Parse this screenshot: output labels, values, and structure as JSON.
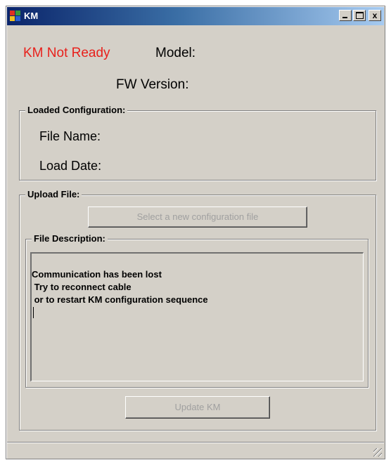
{
  "window": {
    "title": "KM"
  },
  "header": {
    "status": "KM Not Ready",
    "model_label": "Model:",
    "fw_version_label": "FW Version:"
  },
  "loaded_configuration": {
    "legend": "Loaded Configuration:",
    "file_name_label": "File Name:",
    "load_date_label": "Load Date:"
  },
  "upload_file": {
    "legend": "Upload File:",
    "select_button": "Select a new configuration file",
    "file_description": {
      "legend": "File Description:",
      "lines": [
        "Communication has been lost",
        " Try to reconnect cable",
        " or to restart KM configuration sequence"
      ]
    },
    "update_button": "Update KM"
  },
  "title_buttons": {
    "close": "x"
  },
  "colors": {
    "status_red": "#e8211c",
    "window_bg": "#d4d0c8",
    "disabled_text": "#a0a0a0"
  },
  "icons": [
    "app-icon",
    "minimize-icon",
    "maximize-icon",
    "close-icon",
    "resize-grip-icon"
  ]
}
